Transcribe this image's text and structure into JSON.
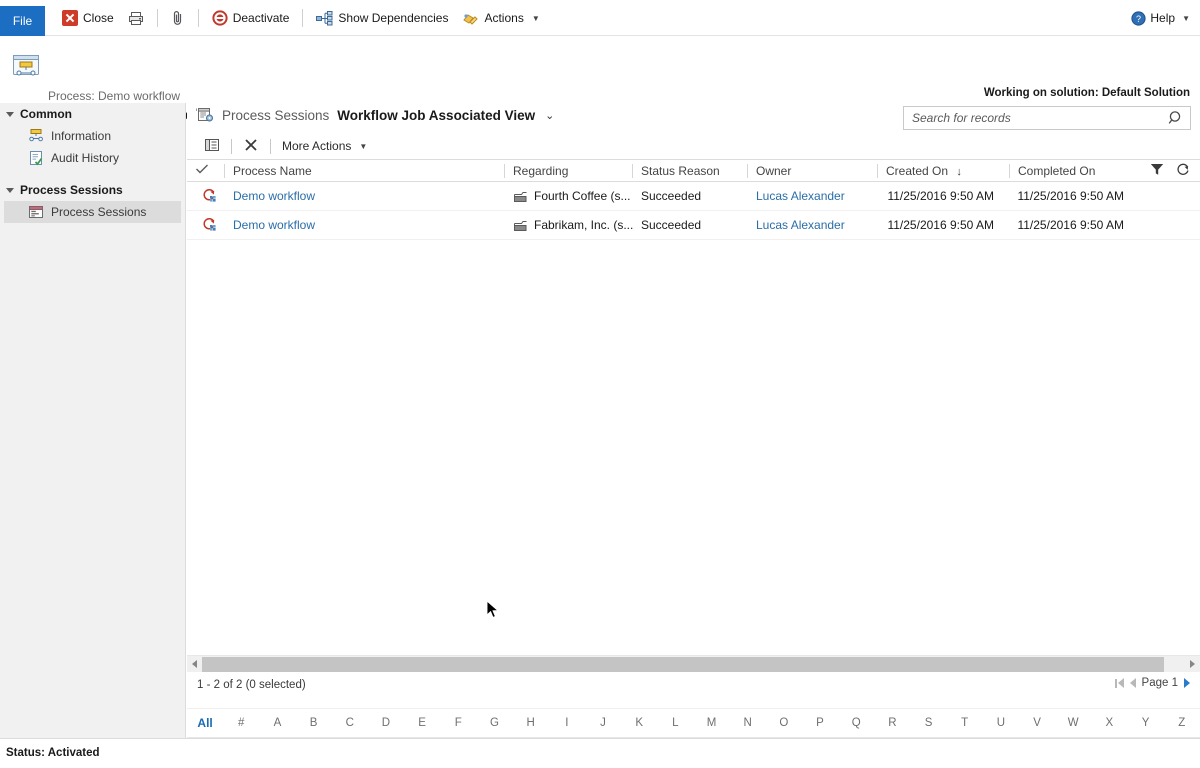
{
  "ribbon": {
    "file_label": "File",
    "items": [
      {
        "label": "Close",
        "icon": "close-icon",
        "underline_index": 0
      },
      {
        "label": "",
        "icon": "print-icon"
      },
      {
        "label": "",
        "icon": "attachment-icon"
      },
      {
        "label": "Deactivate",
        "icon": "deactivate-icon"
      },
      {
        "label": "Show Dependencies",
        "icon": "dependencies-icon"
      },
      {
        "label": "Actions",
        "icon": "actions-icon",
        "has_caret": true
      }
    ],
    "close_label": "Close",
    "deactivate_label": "Deactivate",
    "show_dependencies_label": "Show Dependencies",
    "actions_label": "Actions",
    "help_label": "Help",
    "help_icon": "help-icon"
  },
  "header": {
    "subtitle": "Process: Demo workflow",
    "title": "Process Sessions",
    "solution_note": "Working on solution: Default Solution",
    "process_icon": "process-icon",
    "entity_icon": "process-session-icon"
  },
  "sidebar": {
    "groups": [
      {
        "label": "Common",
        "items": [
          {
            "label": "Information",
            "icon": "information-icon",
            "selected": false
          },
          {
            "label": "Audit History",
            "icon": "audit-history-icon",
            "selected": false
          }
        ]
      },
      {
        "label": "Process Sessions",
        "items": [
          {
            "label": "Process Sessions",
            "icon": "process-session-icon",
            "selected": true
          }
        ]
      }
    ]
  },
  "grid": {
    "breadcrumb": "Process Sessions",
    "view_name": "Workflow Job Associated View",
    "view_chevron": "chevron-down-icon",
    "search": {
      "placeholder": "Search for records",
      "value": "",
      "icon": "search-icon"
    },
    "actionbar": {
      "chart_label": "",
      "delete_label": "",
      "more_actions_label": "More Actions"
    },
    "columns": [
      {
        "key": "check",
        "label": ""
      },
      {
        "key": "name",
        "label": "Process Name"
      },
      {
        "key": "regarding",
        "label": "Regarding"
      },
      {
        "key": "status",
        "label": "Status Reason"
      },
      {
        "key": "owner",
        "label": "Owner"
      },
      {
        "key": "created",
        "label": "Created On",
        "sort": "desc",
        "sort_arrow": "↓"
      },
      {
        "key": "completed",
        "label": "Completed On"
      }
    ],
    "header_tools": {
      "filter_icon": "filter-icon",
      "refresh_icon": "refresh-icon"
    },
    "rows": [
      {
        "name": "Demo workflow",
        "regarding": "Fourth Coffee (s...",
        "status": "Succeeded",
        "owner": "Lucas Alexander",
        "created": "11/25/2016 9:50 AM",
        "completed": "11/25/2016 9:50 AM",
        "row_icon": "workflow-session-icon",
        "regarding_icon": "account-icon"
      },
      {
        "name": "Demo workflow",
        "regarding": "Fabrikam, Inc. (s...",
        "status": "Succeeded",
        "owner": "Lucas Alexander",
        "created": "11/25/2016 9:50 AM",
        "completed": "11/25/2016 9:50 AM",
        "row_icon": "workflow-session-icon",
        "regarding_icon": "account-icon"
      }
    ],
    "footer": {
      "count_text": "1 - 2 of 2 (0 selected)",
      "page_label": "Page 1",
      "alphabet": [
        "All",
        "#",
        "A",
        "B",
        "C",
        "D",
        "E",
        "F",
        "G",
        "H",
        "I",
        "J",
        "K",
        "L",
        "M",
        "N",
        "O",
        "P",
        "Q",
        "R",
        "S",
        "T",
        "U",
        "V",
        "W",
        "X",
        "Y",
        "Z"
      ]
    }
  },
  "statusbar": {
    "text": "Status: Activated"
  },
  "colors": {
    "file_tab": "#1b6ec2",
    "link": "#2a6ea8",
    "accent_blue": "#1a6bb5",
    "sidebar_bg": "#f1f1f1",
    "selected_nav": "#dcdcdc"
  }
}
